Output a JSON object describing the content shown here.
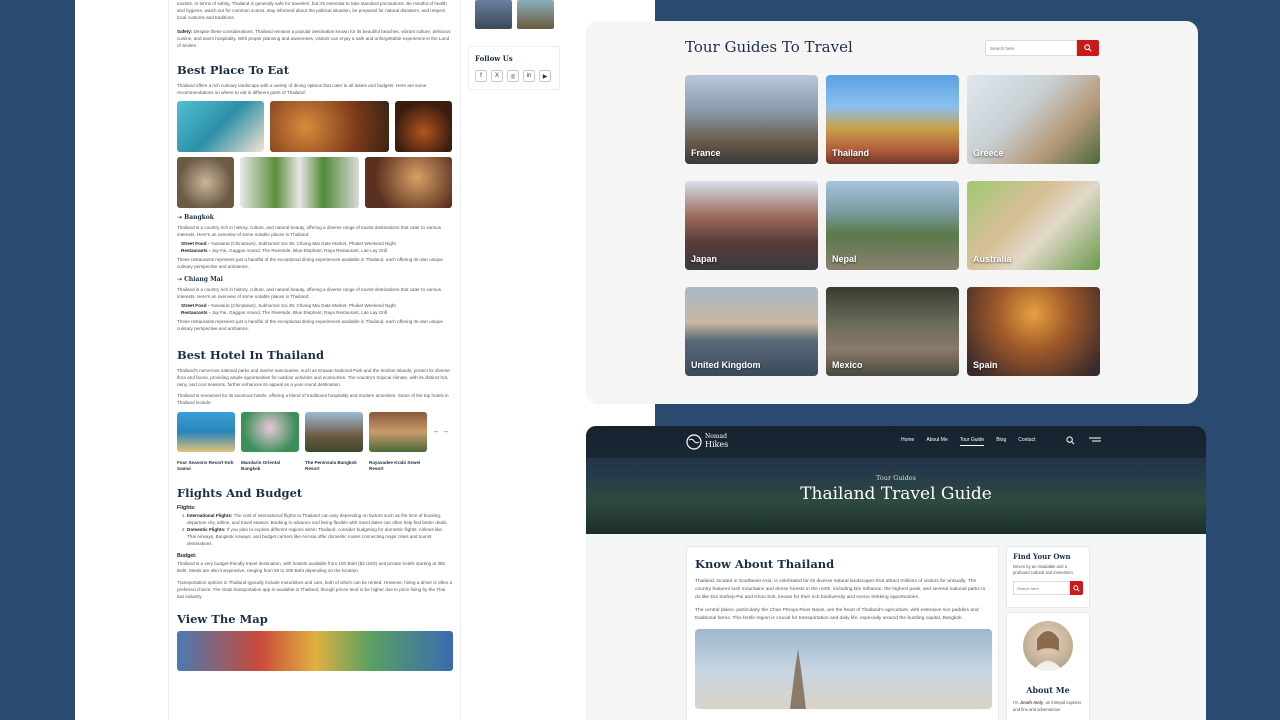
{
  "article": {
    "intro_text": "tourists. In terms of safety, Thailand is generally safe for travelers, but it's essential to take standard precautions. Be mindful of health and hygiene, watch out for common scams, stay informed about the political situation, be prepared for natural disasters, and respect local customs and traditions.",
    "safety_label": "Safety:",
    "safety_text": "Despite these considerations, Thailand remains a popular destination known for its beautiful beaches, vibrant culture, delicious cuisine, and warm hospitality. With proper planning and awareness, visitors can enjoy a safe and unforgettable experience in the Land of Smiles.",
    "eat_heading": "Best Place To Eat",
    "eat_intro": "Thailand offers a rich culinary landscape with a variety of dining options that cater to all tastes and budgets. Here are some recommendations on where to eat in different parts of Thailand:",
    "cities": [
      {
        "name": "Bangkok",
        "desc": "Thailand is a country rich in history, culture, and natural beauty, offering a diverse range of tourist destinations that cater to various interests. Here's an overview of some notable places in Thailand:",
        "street_label": "Street Food -",
        "street_text": "Yaowarat (Chinatown), Sukhumvit Soi 38, Chiang Mai Gate Market, Phuket Weekend Night",
        "rest_label": "Restaurants -",
        "rest_text": "Jay Fai, Gaggan Anand, The Riverside, Blue Elephant, Raya Restaurant, Lae Lay Grill",
        "outro": "These restaurants represent just a handful of the exceptional dining experiences available in Thailand, each offering its own unique culinary perspective and ambiance."
      },
      {
        "name": "Chiang Mai",
        "desc": "Thailand is a country rich in history, culture, and natural beauty, offering a diverse range of tourist destinations that cater to various interests. Here's an overview of some notable places in Thailand:",
        "street_label": "Street Food -",
        "street_text": "Yaowarat (Chinatown), Sukhumvit Soi 38, Chiang Mai Gate Market, Phuket Weekend Night",
        "rest_label": "Restaurants -",
        "rest_text": "Jay Fai, Gaggan Anand, The Riverside, Blue Elephant, Raya Restaurant, Lae Lay Grill",
        "outro": "These restaurants represent just a handful of the exceptional dining experiences available in Thailand, each offering its own unique culinary perspective and ambiance."
      }
    ],
    "hotel_heading": "Best Hotel In Thailand",
    "hotel_p1": "Thailand's numerous national parks and marine sanctuaries, such as Erawan National Park and the Similan Islands, protect its diverse flora and fauna, providing ample opportunities for outdoor activities and ecotourism. The country's tropical climate, with its distinct hot, rainy, and cool seasons, further enhances its appeal as a year-round destination.",
    "hotel_p2": "Thailand is renowned for its luxurious hotels, offering a blend of traditional hospitality and modern amenities. Some of the top hotels in Thailand include:",
    "hotels": [
      "Four Seasons Resort Koh Samui",
      "Mandarin Oriental Bangkok",
      "The Peninsula Bangkok Resort",
      "Rayavadee Krabi Sewei Resort"
    ],
    "hotel_arrows": "← →",
    "flights_heading": "Flights And Budget",
    "flights_label": "Flights:",
    "flight_items": [
      {
        "label": "International Flights:",
        "text": "The cost of international flights to Thailand can vary depending on factors such as the time of booking, departure city, airline, and travel season. Booking in advance and being flexible with travel dates can often help find better deals."
      },
      {
        "label": "Domestic Flights:",
        "text": "If you plan to explore different regions within Thailand, consider budgeting for domestic flights. Airlines like Thai Airways, Bangkok Airways, and budget carriers like AirAsia offer domestic routes connecting major cities and tourist destinations."
      }
    ],
    "budget_label": "Budget:",
    "budget_text": "Thailand is a very budget-friendly travel destination, with hostels available from 100 Baht ($3 USD) and private hotels starting at 360 Baht. Meals are also inexpensive, ranging from 50 to 200 Baht depending on the location.",
    "transport_text": "Transportation options in Thailand typically include motorbikes and cars, both of which can be rented. However, hiring a driver is often a preferred choice. The Grab transportation app is available in Thailand, though prices tend to be higher due to price fixing by the Thai taxi industry.",
    "map_heading": "View The Map"
  },
  "follow": {
    "title": "Follow Us",
    "icons": [
      "f",
      "X",
      "◎",
      "in",
      "▶"
    ]
  },
  "tour": {
    "title": "Tour Guides To Travel",
    "search_placeholder": "Search here",
    "countries": [
      "France",
      "Thailand",
      "Greece",
      "Japan",
      "Nepal",
      "Australia",
      "United Kingdom",
      "Mexico",
      "Spain"
    ],
    "accent": "#c91a1a"
  },
  "site": {
    "logo_top": "Nomad",
    "logo_bottom": "Hikes",
    "menu": [
      "Home",
      "About Me",
      "Tour Guide",
      "Blog",
      "Contact"
    ],
    "active_menu": "Tour Guide",
    "hero_sub": "Tour Guides",
    "hero_title": "Thailand Travel Guide",
    "know_heading": "Know About Thailand",
    "know_p1": "Thailand, located in Southeast Asia, is celebrated for its diverse natural landscapes that attract millions of visitors for annually. The country features lush mountains and dense forests in the north, including Doi Inthanon, the highest peak, and several national parks to do like Doi Suthep-Pui and Khao Sok, known for their rich biodiversity and scenic trekking opportunities.",
    "know_p2": "The central plains, particularly the Chao Phraya River Basin, are the heart of Thailand's agriculture, with extensive rice paddies and traditional farms. This fertile region is crucial for transportation and daily life, especially around the bustling capital, Bangkok.",
    "find_heading": "Find Your Own",
    "find_text": "Driven by an insatiable and a profound cultural and immersion.",
    "find_placeholder": "Search here",
    "about_heading": "About Me",
    "about_text_prefix": "I'm ",
    "about_name": "Jinath Amly",
    "about_text_suffix": ", an intrepid explorer and fine and adventurous"
  }
}
